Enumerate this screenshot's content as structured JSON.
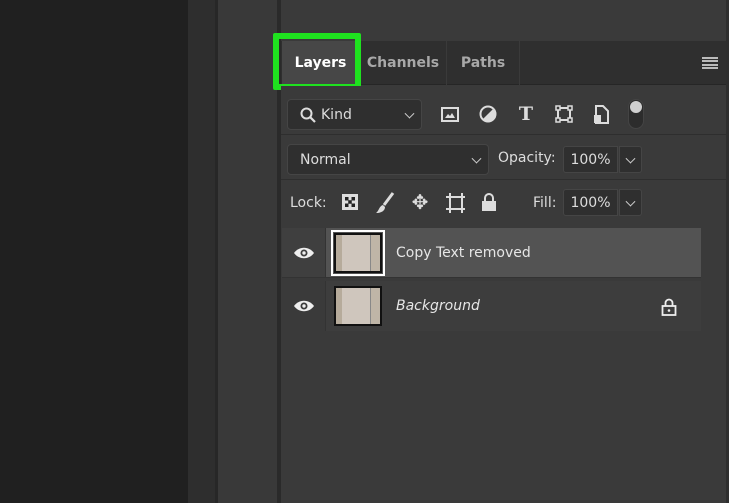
{
  "tabs": [
    {
      "label": "Layers",
      "active": true
    },
    {
      "label": "Channels"
    },
    {
      "label": "Paths"
    }
  ],
  "highlight_color": "#1fe21f",
  "filter": {
    "value": "Kind",
    "icons": [
      "image-filter-icon",
      "adjustment-filter-icon",
      "type-filter-icon",
      "shape-filter-icon",
      "smart-object-filter-icon",
      "filter-toggle-icon"
    ]
  },
  "blend": {
    "mode": "Normal",
    "opacity_label": "Opacity:",
    "opacity": "100%"
  },
  "lock": {
    "label": "Lock:",
    "icons": [
      "lock-transparent-icon",
      "lock-image-icon",
      "lock-position-icon",
      "lock-artboard-icon",
      "lock-all-icon"
    ],
    "fill_label": "Fill:",
    "fill": "100%"
  },
  "layers": [
    {
      "name": "Copy Text removed",
      "selected": true,
      "visible": true
    },
    {
      "name": "Background",
      "locked": true,
      "italic": true,
      "visible": true
    }
  ]
}
